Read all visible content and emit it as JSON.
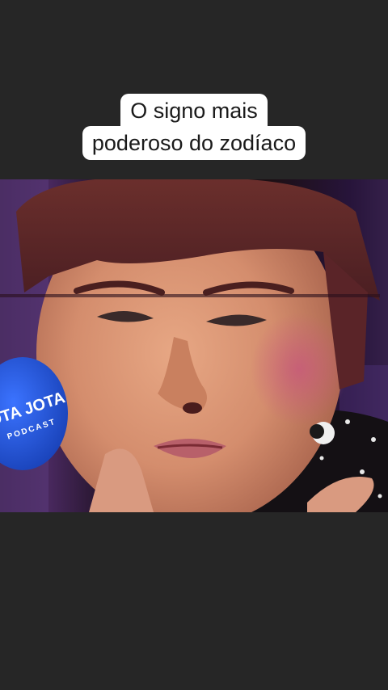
{
  "caption": {
    "line1": "O signo mais",
    "line2": "poderoso do zodíaco"
  },
  "video": {
    "mic_label": "JOTA JOTA",
    "mic_sub": "PODCAST"
  },
  "colors": {
    "background": "#262626",
    "caption_bg": "#ffffff",
    "caption_text": "#1a1a1a",
    "mic_blue": "#1f52d8"
  }
}
